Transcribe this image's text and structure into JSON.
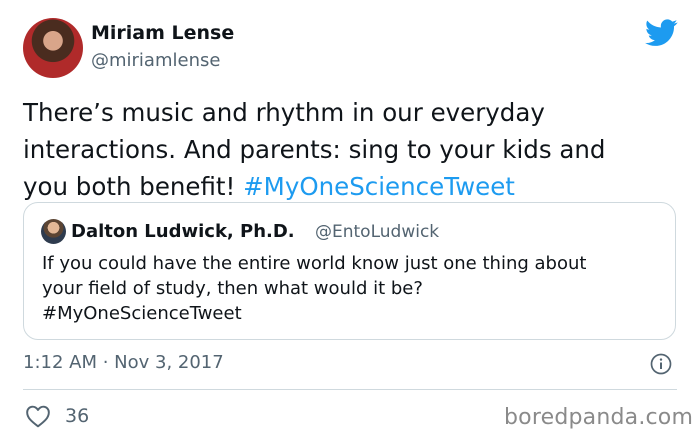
{
  "tweet": {
    "author_name": "Miriam Lense",
    "author_handle": "@miriamlense",
    "text": "There’s music and rhythm in our everyday\ninteractions. And parents: sing to your kids and\nyou both benefit! ",
    "hashtag": "#MyOneScienceTweet",
    "timestamp": "1:12 AM · Nov 3, 2017",
    "like_count": "36"
  },
  "quote": {
    "author_name": "Dalton Ludwick, Ph.D.",
    "author_handle": "@EntoLudwick",
    "text": "If you could have the entire world know just one thing about\nyour field of study, then what would it be?\n#MyOneScienceTweet"
  },
  "icons": {
    "logo": "twitter-bird-icon",
    "info": "info-icon",
    "like": "heart-icon"
  },
  "colors": {
    "accent": "#1d9bf0",
    "secondary_text": "#536471",
    "border": "#cfd9de"
  },
  "watermark": "boredpanda.com"
}
